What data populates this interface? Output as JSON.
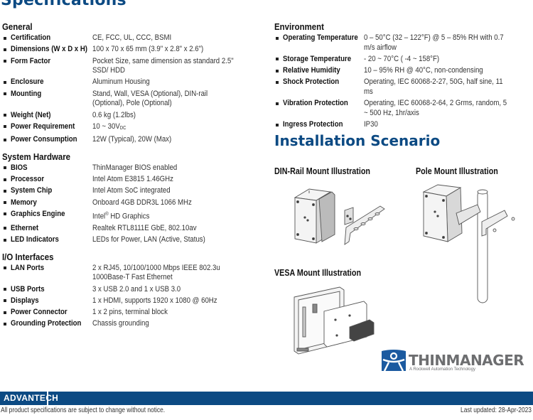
{
  "page_title": "Specifications",
  "colors": {
    "brand_blue": "#0c4a83",
    "logo_gray": "#6d6e70"
  },
  "general": {
    "heading": "General",
    "items": [
      {
        "label": "Certification",
        "value": "CE, FCC, UL, CCC, BSMI"
      },
      {
        "label": "Dimensions (W x D x H)",
        "value": "100 x 70 x 65 mm (3.9\" x 2.8\" x 2.6\")"
      },
      {
        "label": "Form Factor",
        "value": "Pocket Size, same dimension as standard 2.5\" SSD/ HDD"
      },
      {
        "label": "Enclosure",
        "value": "Aluminum Housing"
      },
      {
        "label": "Mounting",
        "value": "Stand, Wall, VESA (Optional), DIN-rail (Optional), Pole (Optional)"
      },
      {
        "label": "Weight (Net)",
        "value": "0.6 kg (1.2lbs)"
      },
      {
        "label": "Power Requirement",
        "value": "10 ~ 30V",
        "value_sub": "DC"
      },
      {
        "label": "Power Consumption",
        "value": "12W (Typical), 20W (Max)"
      }
    ]
  },
  "system_hardware": {
    "heading": "System Hardware",
    "items": [
      {
        "label": "BIOS",
        "value": "ThinManager BIOS enabled"
      },
      {
        "label": "Processor",
        "value": "Intel Atom E3815 1.46GHz"
      },
      {
        "label": "System Chip",
        "value": "Intel Atom SoC integrated"
      },
      {
        "label": "Memory",
        "value": "Onboard 4GB DDR3L 1066 MHz"
      },
      {
        "label": "Graphics Engine",
        "value_pre": "Intel",
        "value_sup": "®",
        "value": " HD Graphics"
      },
      {
        "label": "Ethernet",
        "value": "Realtek RTL8111E GbE, 802.10av"
      },
      {
        "label": "LED Indicators",
        "value": "LEDs for Power, LAN (Active, Status)"
      }
    ]
  },
  "io_interfaces": {
    "heading": "I/O Interfaces",
    "items": [
      {
        "label": "LAN Ports",
        "value": "2 x RJ45, 10/100/1000 Mbps IEEE 802.3u 1000Base-T Fast Ethernet"
      },
      {
        "label": "USB Ports",
        "value": "3 x USB 2.0 and 1 x USB 3.0"
      },
      {
        "label": "Displays",
        "value": "1 x HDMI, supports 1920 x 1080 @ 60Hz"
      },
      {
        "label": "Power Connector",
        "value": "1 x 2 pins, terminal block"
      },
      {
        "label": "Grounding Protection",
        "value": "Chassis grounding"
      }
    ]
  },
  "environment": {
    "heading": "Environment",
    "items": [
      {
        "label": "Operating Temperature",
        "value": "0 – 50°C (32 – 122°F) @ 5 – 85% RH with 0.7 m/s airflow"
      },
      {
        "label": "Storage Temperature",
        "value": "- 20 ~ 70°C ( -4 ~ 158°F)"
      },
      {
        "label": "Relative Humidity",
        "value": "10 – 95% RH @ 40°C, non-condensing"
      },
      {
        "label": "Shock Protection",
        "value": "Operating, IEC 60068-2-27, 50G, half sine, 11 ms"
      },
      {
        "label": "Vibration Protection",
        "value": "Operating, IEC 60068-2-64, 2 Grms, random, 5 ~ 500 Hz, 1hr/axis"
      },
      {
        "label": "Ingress Protection",
        "value": "IP30"
      }
    ]
  },
  "installation": {
    "heading": "Installation Scenario",
    "din_rail_title": "DIN-Rail Mount Illustration",
    "pole_title": "Pole Mount Illustration",
    "vesa_title": "VESA Mount Illustration"
  },
  "thinmanager_logo": {
    "word": "THINMANAGER",
    "tagline": "A Rockwell Automation Technology"
  },
  "footer": {
    "brand": "ADVANTECH",
    "note": "All product specifications are subject to change without notice.",
    "last_updated": "Last updated: 28-Apr-2023"
  }
}
